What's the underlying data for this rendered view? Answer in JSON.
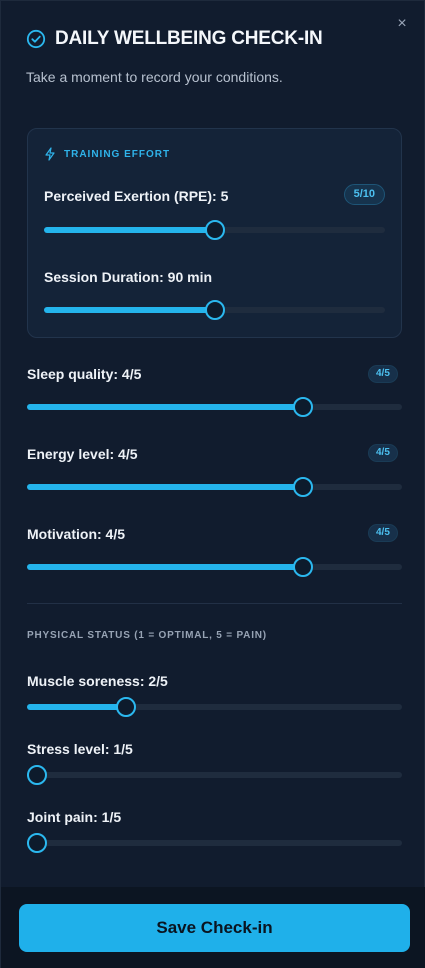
{
  "header": {
    "title": "DAILY WELLBEING CHECK-IN",
    "subtitle": "Take a moment to record your conditions.",
    "close_glyph": "×",
    "title_icon": "check-circle-icon",
    "close_icon": "close-icon"
  },
  "training": {
    "title": "TRAINING EFFORT",
    "icon": "lightning-icon",
    "rpe": {
      "label": "Perceived Exertion (RPE): 5",
      "badge": "5/10",
      "value": 5,
      "min": 0,
      "max": 10
    },
    "duration": {
      "label": "Session Duration: 90 min",
      "value": 90,
      "min": 0,
      "max": 180
    }
  },
  "ratings": [
    {
      "label": "Sleep quality: 4/5",
      "badge": "4/5",
      "value": 4,
      "min": 1,
      "max": 5
    },
    {
      "label": "Energy level: 4/5",
      "badge": "4/5",
      "value": 4,
      "min": 1,
      "max": 5
    },
    {
      "label": "Motivation: 4/5",
      "badge": "4/5",
      "value": 4,
      "min": 1,
      "max": 5
    }
  ],
  "physical": {
    "title": "PHYSICAL STATUS (1 = OPTIMAL, 5 = PAIN)",
    "items": [
      {
        "label": "Muscle soreness: 2/5",
        "value": 2,
        "min": 1,
        "max": 5
      },
      {
        "label": "Stress level: 1/5",
        "value": 1,
        "min": 1,
        "max": 5
      },
      {
        "label": "Joint pain: 1/5",
        "value": 1,
        "min": 1,
        "max": 5
      }
    ]
  },
  "footer": {
    "save_label": "Save Check-in"
  },
  "colors": {
    "accent": "#1fb0ea",
    "background": "#111c2e",
    "card": "#142338"
  }
}
